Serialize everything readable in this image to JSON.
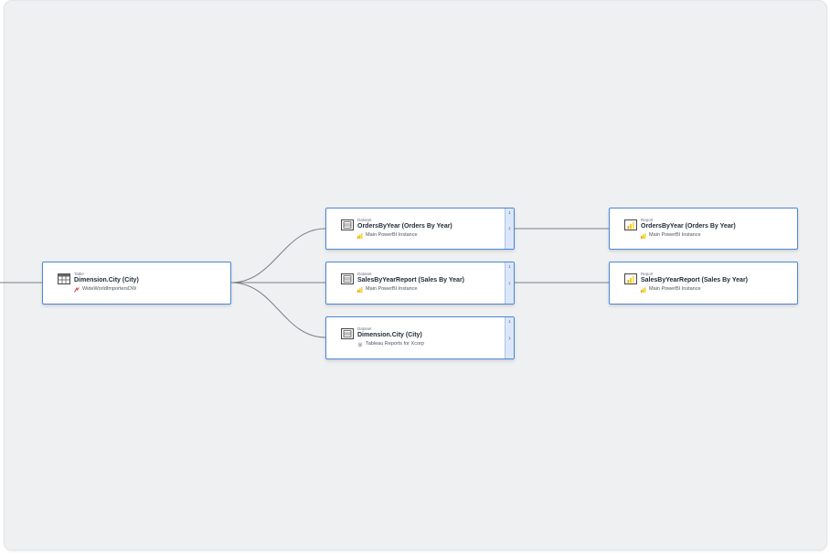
{
  "nodes": {
    "source": {
      "type": "Table",
      "name": "Dimension.City (City)",
      "sub": "WideWorldImportersDW"
    },
    "ds1": {
      "type": "Dataset",
      "name": "OrdersByYear (Orders By Year)",
      "sub": "Main PowerBI Instance",
      "count": "1",
      "chevron": "‹"
    },
    "ds2": {
      "type": "Dataset",
      "name": "SalesByYearReport (Sales By Year)",
      "sub": "Main PowerBI Instance",
      "count": "1",
      "chevron": "‹"
    },
    "ds3": {
      "type": "Dataset",
      "name": "Dimension.City (City)",
      "sub": "Tableau Reports for Xcorp",
      "count": "1",
      "chevron": "›"
    },
    "rp1": {
      "type": "Report",
      "name": "OrdersByYear (Orders By Year)",
      "sub": "Main PowerBI Instance"
    },
    "rp2": {
      "type": "Report",
      "name": "SalesByYearReport (Sales By Year)",
      "sub": "Main PowerBI Instance"
    }
  },
  "icons": {
    "table": "table-icon",
    "dataset": "dataset-icon",
    "report": "report-icon",
    "powerbi": "powerbi-icon",
    "sql": "sql-server-icon",
    "tableau": "tableau-icon"
  },
  "colors": {
    "node_border": "#4d86d6",
    "expander_bg": "#dbe7f8",
    "canvas": "#eef0f2",
    "powerbi": "#f2c811"
  }
}
